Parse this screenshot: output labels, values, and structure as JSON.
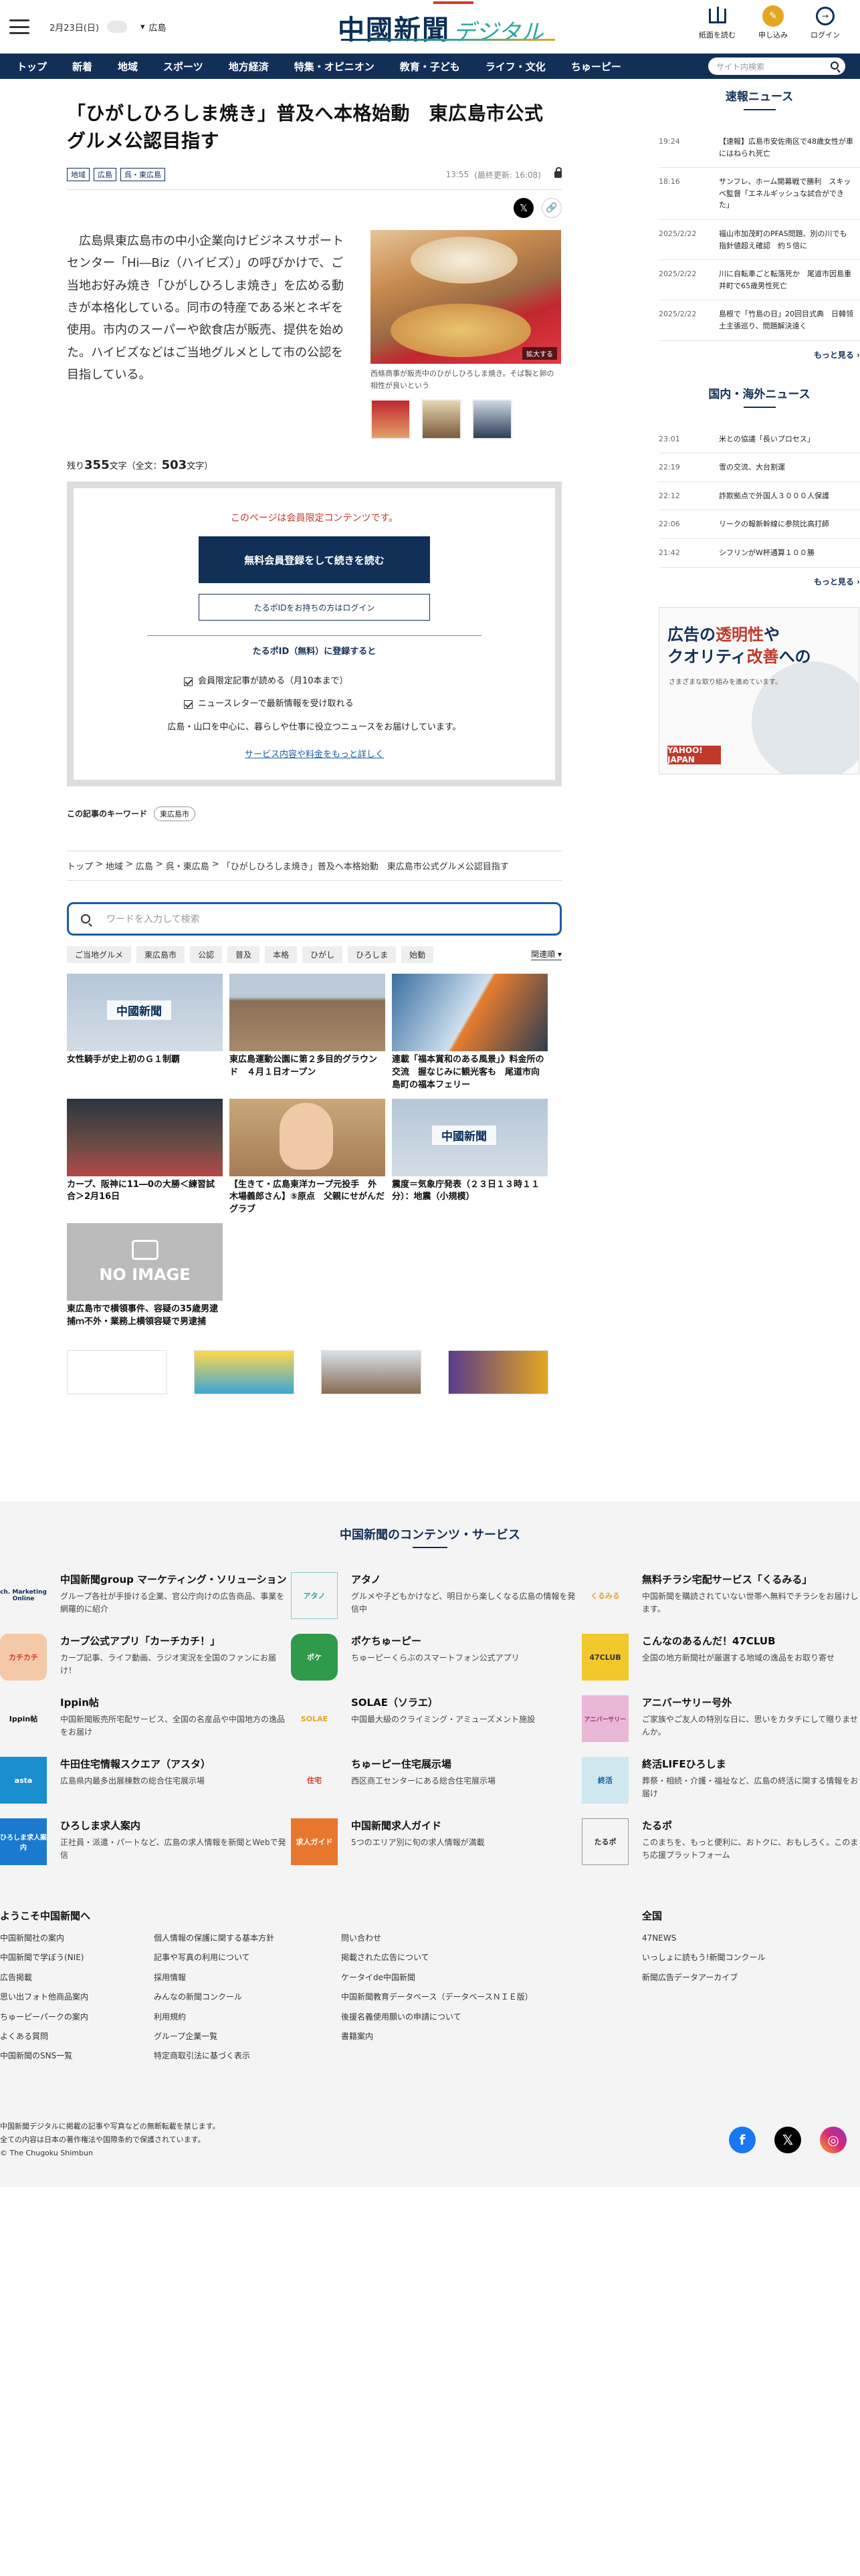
{
  "header": {
    "date": "2月23日(日)",
    "area": "広島",
    "logo_main": "中國新聞",
    "logo_sub": "デジタル",
    "buttons": [
      {
        "label": "紙面を読む"
      },
      {
        "label": "申し込み"
      },
      {
        "label": "ログイン"
      }
    ]
  },
  "nav": {
    "items": [
      "トップ",
      "新着",
      "地域",
      "スポーツ",
      "地方経済",
      "特集・オピニオン",
      "教育・子ども",
      "ライフ・文化",
      "ちゅーピー"
    ],
    "search_placeholder": "サイト内検索"
  },
  "article": {
    "title": "「ひがしひろしま焼き」普及へ本格始動　東広島市公式グルメ公認目指す",
    "tags": [
      "地域",
      "広島",
      "呉・東広島"
    ],
    "time": "13:55",
    "updated": "(最終更新: 16:08)",
    "body": "　広島県東広島市の中小企業向けビジネスサポートセンター「Hi―Biz（ハイビズ）」の呼びかけで、ご当地お好み焼き「ひがしひろしま焼き」を広める動きが本格化している。同市の特産である米とネギを使用。市内のスーパーや飲食店が販売、提供を始めた。ハイビズなどはご当地グルメとして市の公認を目指している。",
    "photo_zoom": "拡大する",
    "photo_caption": "西條商事が販売中のひがしひろしま焼き。そば製と卵の相性が良いという",
    "remain_prefix": "残り",
    "remain_count": "355",
    "remain_mid": "文字（全文：",
    "total_count": "503",
    "remain_suffix": "文字）"
  },
  "paywall": {
    "note": "このページは会員限定コンテンツです。",
    "register": "無料会員登録をして続きを読む",
    "login": "たるポIDをお持ちの方はログイン",
    "heading": "たるポID（無料）に登録すると",
    "benefits": [
      "会員限定記事が読める（月10本まで）",
      "ニュースレターで最新情報を受け取れる"
    ],
    "desc": "広島・山口を中心に、暮らしや仕事に役立つニュースをお届けしています。",
    "link": "サービス内容や料金をもっと詳しく"
  },
  "keywords": {
    "label": "この記事のキーワード",
    "items": [
      "東広島市"
    ]
  },
  "breadcrumb": [
    "トップ",
    ">",
    "地域",
    ">",
    "広島",
    ">",
    "呉・東広島",
    ">",
    "「ひがしひろしま焼き」普及へ本格始動　東広島市公式グルメ公認目指す"
  ],
  "wordsearch": {
    "placeholder": "ワードを入力して検索",
    "chips": [
      "ご当地グルメ",
      "東広島市",
      "公認",
      "普及",
      "本格",
      "ひがし",
      "ひろしま",
      "始動"
    ],
    "sort": "関連順"
  },
  "related": [
    {
      "title": "女性騎手が史上初のＧ１制覇"
    },
    {
      "title": "東広島運動公園に第２多目的グラウンド　４月１日オープン"
    },
    {
      "title": "連載「福本賞和のある風景」》料金所の交流　握なじみに観光客も　尾道市向島町の福本フェリー"
    },
    {
      "title": "カープ、阪神に11―0の大勝＜練習試合＞2月16日"
    },
    {
      "title": "【生きて・広島東洋カープ元投手　外木場義郎さん】⑤原点　父親にせがんだグラブ"
    },
    {
      "title": "震度＝気象庁発表（２３日１３時１１分）：地震（小規模）"
    },
    {
      "title": "東広島市で横領事件、容疑の35歳男逮捕ｍ不外・業務上横領容疑で男逮捕"
    }
  ],
  "related_img_labels": {
    "news": "中國新聞",
    "noimage": "NO IMAGE"
  },
  "sidebar": {
    "breaking_title": "速報ニュース",
    "breaking": [
      {
        "time": "19:24",
        "text": "【速報】広島市安佐南区で48歳女性が車にはねられ死亡"
      },
      {
        "time": "18:16",
        "text": "サンフレ、ホーム開幕戦で勝利　スキッベ監督「エネルギッシュな試合ができた」"
      },
      {
        "time": "2025/2/22",
        "text": "福山市加茂町のPFAS問題、別の川でも指針値超え確認　約５倍に"
      },
      {
        "time": "2025/2/22",
        "text": "川に自転車ごと転落死か　尾道市因島重井町で65歳男性死亡"
      },
      {
        "time": "2025/2/22",
        "text": "島根で「竹島の日」20回目式典　日韓领土主張巡り、問題解決遠く"
      }
    ],
    "more": "もっと見る",
    "world_title": "国内・海外ニュース",
    "world": [
      {
        "time": "23:01",
        "text": "米との協議「長いプロセス」"
      },
      {
        "time": "22:19",
        "text": "雪の交流、大台割運"
      },
      {
        "time": "22:12",
        "text": "詐欺拠点で外国人３０００人保護"
      },
      {
        "time": "22:06",
        "text": "リークの報新幹線に参院比高打師"
      },
      {
        "time": "21:42",
        "text": "シフリンがW杯通算１００勝"
      }
    ],
    "more2": "もっと見る",
    "ad": {
      "line1a": "広告の",
      "line1b": "透明性",
      "line1c": "や",
      "line2a": "クオリティ",
      "line2b": "改善",
      "line2c": "への",
      "line3": "さまざまな取り組みを進めています。",
      "brand": "YAHOO! JAPAN"
    }
  },
  "footer": {
    "services_title": "中国新聞のコンテンツ・サービス",
    "services": [
      {
        "logo": "ch. Marketing Online",
        "name": "中国新聞group マーケティング・ソリューション",
        "desc": "グループ各社が手掛ける企業、官公庁向けの広告商品、事業を網羅的に紹介"
      },
      {
        "logo": "アタノ",
        "name": "アタノ",
        "desc": "グルメや子どもかけなど、明日から楽しくなる広島の情報を発信中"
      },
      {
        "logo": "くるみる",
        "name": "無料チラシ宅配サービス「くるみる」",
        "desc": "中国新聞を購読されていない世帯へ無料でチラシをお届けします。"
      },
      {
        "logo": "カチカチ",
        "name": "カープ公式アプリ「カーチカチ！」",
        "desc": "カープ記事、ライフ動画、ラジオ実況を全国のファンにお届け！"
      },
      {
        "logo": "ポケ",
        "name": "ポケちゅーピー",
        "desc": "ちゅーピーくらぶのスマートフォン公式アプリ"
      },
      {
        "logo": "47CLUB",
        "name": "こんなのあるんだ！47CLUB",
        "desc": "全国の地方新聞社が厳選する地域の逸品をお取り寄せ"
      },
      {
        "logo": "Ippin帖",
        "name": "Ippin帖",
        "desc": "中国新聞販売所宅配サービス、全国の名産品や中国地方の逸品をお届け"
      },
      {
        "logo": "SOLAE",
        "name": "SOLAE（ソラエ）",
        "desc": "中国最大級のクライミング・アミューズメント施設"
      },
      {
        "logo": "アニバーサリー",
        "name": "アニバーサリー号外",
        "desc": "ご家族やご友人の特別な日に、思いをカタチにして贈りませんか。"
      },
      {
        "logo": "asta",
        "name": "牛田住宅情報スクエア（アスタ）",
        "desc": "広島県内最多出展棟数の総合住宅展示場"
      },
      {
        "logo": "住宅",
        "name": "ちゅーピー住宅展示場",
        "desc": "西区商工センターにある総合住宅展示場"
      },
      {
        "logo": "終活",
        "name": "終活LIFEひろしま",
        "desc": "葬祭・相続・介護・福祉など、広島の終活に関する情報をお届け"
      },
      {
        "logo": "ひろしま求人案内",
        "name": "ひろしま求人案内",
        "desc": "正社員・派遣・パートなど、広島の求人情報を新聞とWebで発信"
      },
      {
        "logo": "求人ガイド",
        "name": "中国新聞求人ガイド",
        "desc": "5つのエリア別に旬の求人情報が満載"
      },
      {
        "logo": "たるポ",
        "name": "たるポ",
        "desc": "このまちを、もっと便利に、おトクに、おもしろく。このまち応援プラットフォーム"
      }
    ],
    "links_title": "ようこそ中国新聞へ",
    "links_col1": [
      "中国新聞社の案内",
      "中国新聞で学ぼう(NIE)",
      "広告掲載",
      "思い出フォト他商品案内",
      "ちゅーピーパークの案内",
      "よくある質問",
      "中国新聞のSNS一覧"
    ],
    "links_col2": [
      "個人情報の保護に関する基本方針",
      "記事や写真の利用について",
      "採用情報",
      "みんなの新聞コンクール",
      "利用規約",
      "グループ企業一覧",
      "特定商取引法に基づく表示"
    ],
    "links_col3": [
      "問い合わせ",
      "掲載された広告について",
      "ケータイde中国新聞",
      "中国新聞教育データベース（データベースＮＩＥ版）",
      "後援名義使用願いの申請について",
      "書籍案内"
    ],
    "zenkoku_title": "全国",
    "zenkoku": [
      "47NEWS",
      "いっしょに読もう!新聞コンクール",
      "新聞広告データアーカイブ"
    ],
    "copy1": "中国新聞デジタルに掲載の記事や写真などの無断転載を禁じます。",
    "copy2": "全ての内容は日本の著作権法や国際条約で保護されています。",
    "copy3": "© The Chugoku Shimbun"
  }
}
